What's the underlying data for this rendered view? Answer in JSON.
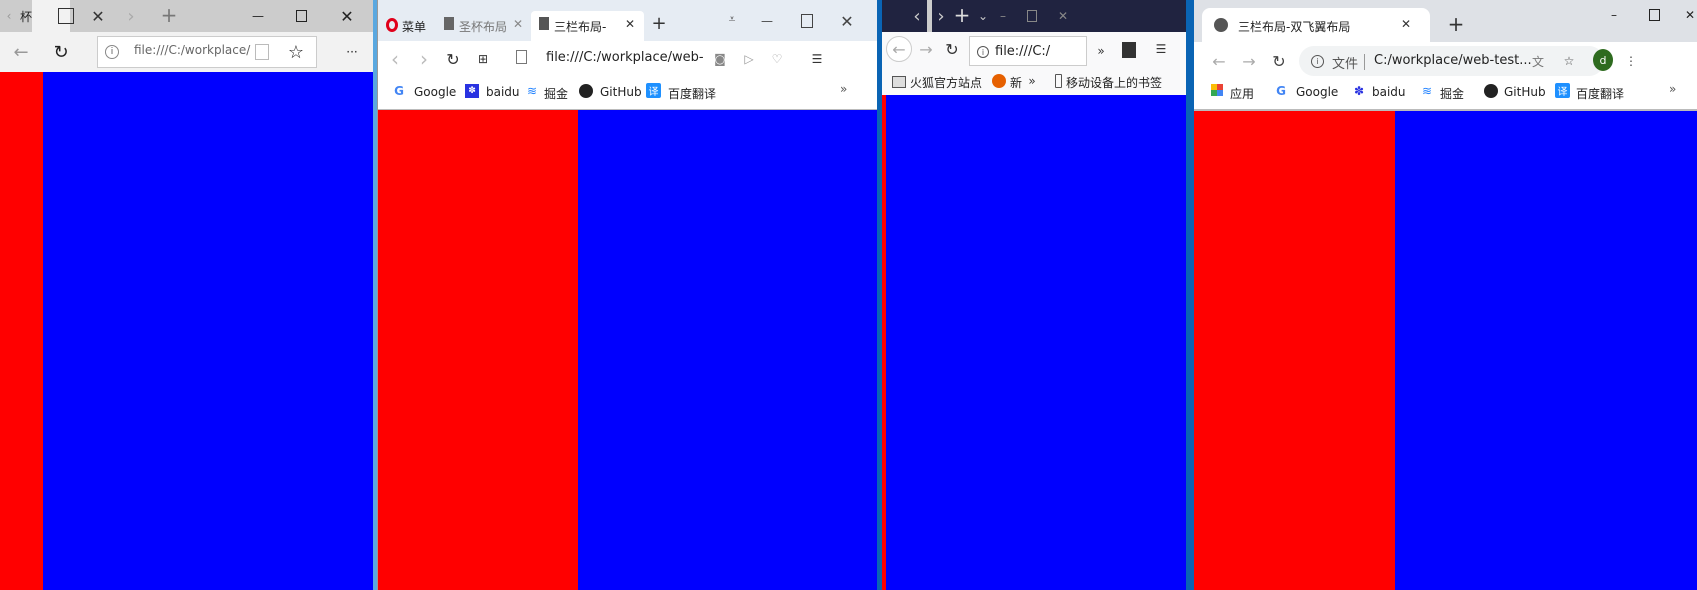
{
  "colors": {
    "left_column": "#ff0000",
    "main_column": "#0000ff"
  },
  "edge": {
    "tab_label": "杯",
    "address": "file:///C:/workplace/",
    "icons": [
      "back-icon",
      "refresh-icon",
      "info-icon",
      "reading-view-icon",
      "favorite-star-icon",
      "more-icon"
    ]
  },
  "opera": {
    "menu_label": "菜单",
    "tabs": [
      {
        "label": "圣杯布局"
      },
      {
        "label": "三栏布局-"
      }
    ],
    "address": "file:///C:/workplace/web-",
    "bookmarks": [
      "Google",
      "baidu",
      "掘金",
      "GitHub",
      "百度翻译"
    ],
    "overflow": "»"
  },
  "firefox": {
    "address": "file:///C:/",
    "bookmarks": [
      "火狐官方站点",
      "新",
      "移动设备上的书签"
    ]
  },
  "chrome": {
    "tab_label": "三栏布局-双飞翼布局",
    "address_prefix": "文件",
    "address": "C:/workplace/web-test...",
    "avatar_letter": "d",
    "bookmarks": [
      "应用",
      "Google",
      "baidu",
      "掘金",
      "GitHub",
      "百度翻译"
    ],
    "overflow": "»"
  }
}
